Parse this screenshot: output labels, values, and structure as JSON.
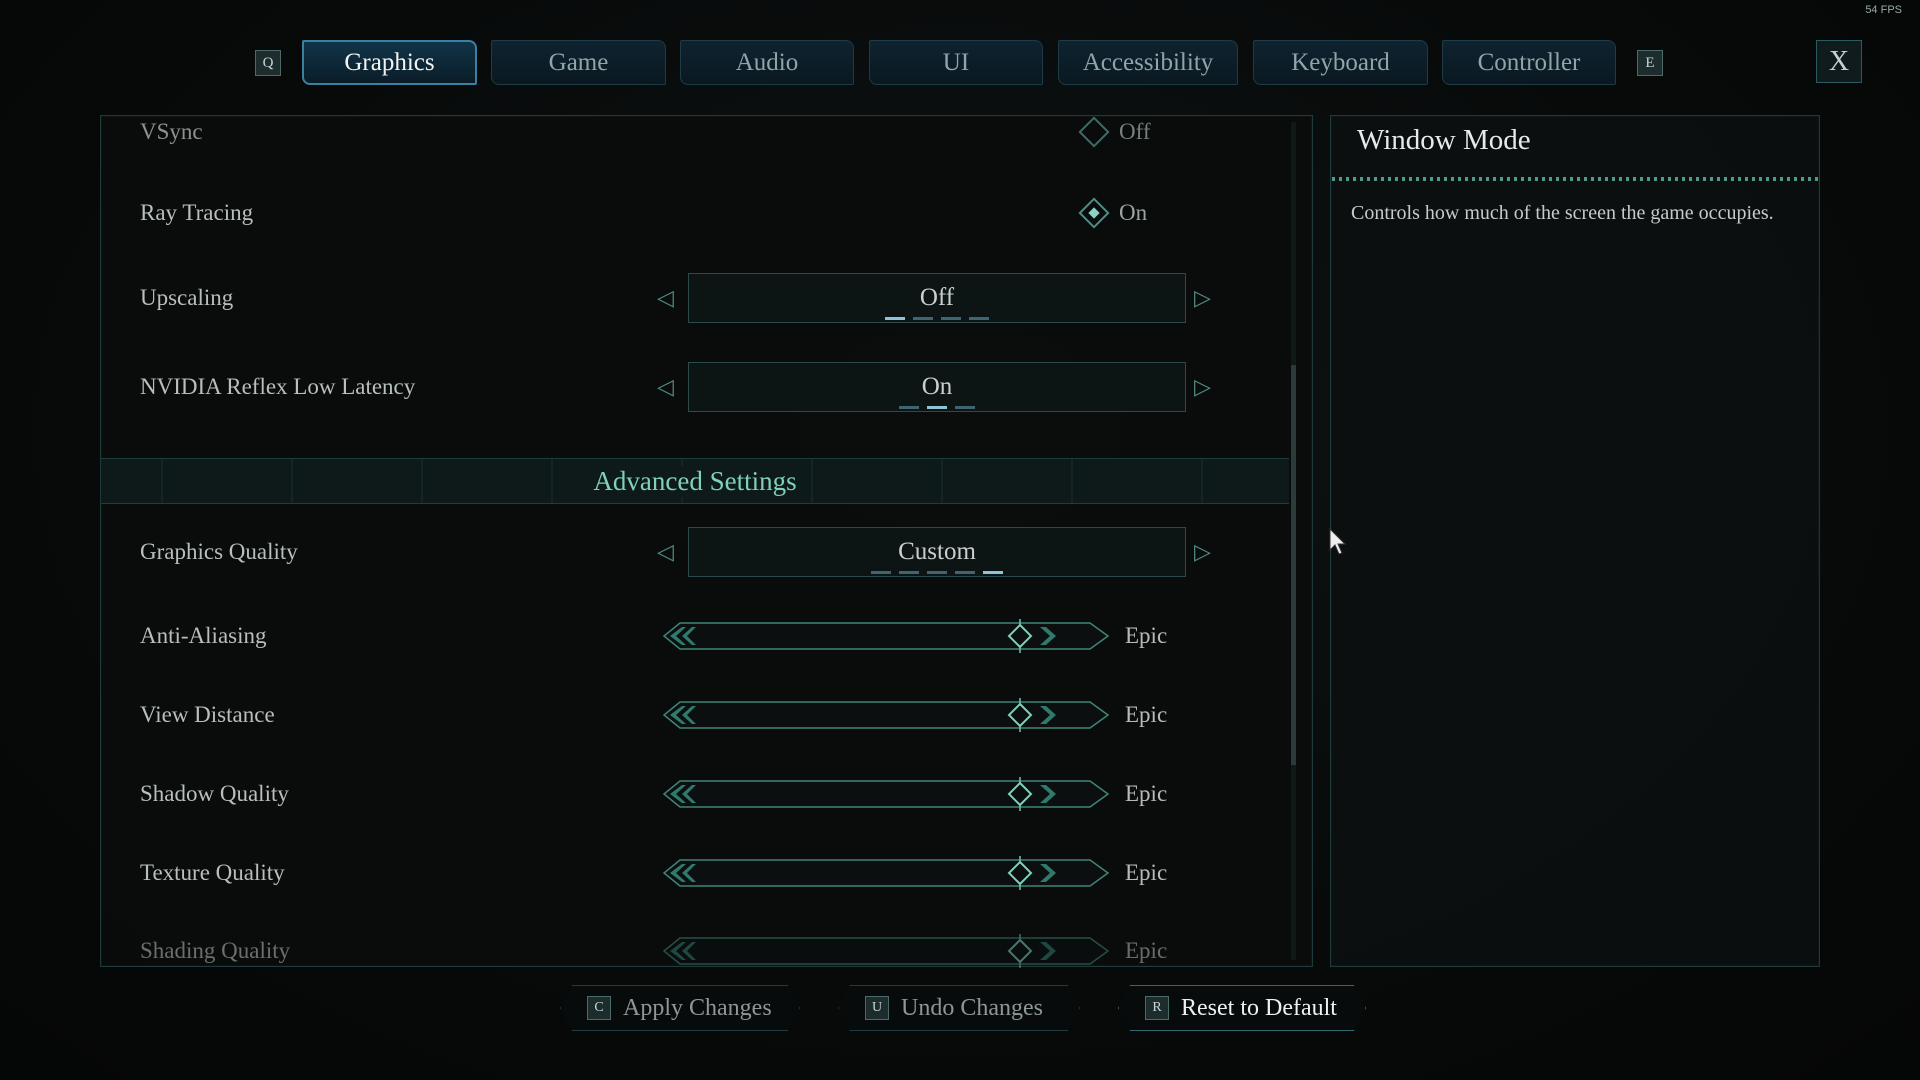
{
  "fps": "54 FPS",
  "tabs": {
    "prev_key": "Q",
    "next_key": "E",
    "items": [
      {
        "label": "Graphics",
        "active": true
      },
      {
        "label": "Game"
      },
      {
        "label": "Audio"
      },
      {
        "label": "UI"
      },
      {
        "label": "Accessibility"
      },
      {
        "label": "Keyboard"
      },
      {
        "label": "Controller"
      }
    ],
    "close_label": "X"
  },
  "settings": {
    "vsync": {
      "label": "VSync",
      "value": "Off",
      "on": false
    },
    "ray_tracing": {
      "label": "Ray Tracing",
      "value": "On",
      "on": true
    },
    "upscaling": {
      "label": "Upscaling",
      "value": "Off",
      "option_count": 4,
      "selected_index": 0
    },
    "reflex": {
      "label": "NVIDIA Reflex Low Latency",
      "value": "On",
      "option_count": 3,
      "selected_index": 1
    },
    "advanced_header": "Advanced Settings",
    "graphics_quality": {
      "label": "Graphics Quality",
      "value": "Custom",
      "option_count": 5,
      "selected_index": 4
    },
    "sliders": [
      {
        "label": "Anti-Aliasing",
        "value": "Epic",
        "level": 1.0
      },
      {
        "label": "View Distance",
        "value": "Epic",
        "level": 1.0
      },
      {
        "label": "Shadow Quality",
        "value": "Epic",
        "level": 1.0
      },
      {
        "label": "Texture Quality",
        "value": "Epic",
        "level": 1.0
      },
      {
        "label": "Shading Quality",
        "value": "Epic",
        "level": 1.0
      }
    ],
    "scroll_position": 0.45
  },
  "info": {
    "title": "Window Mode",
    "description": "Controls how much of the screen the game occupies."
  },
  "footer": [
    {
      "key": "C",
      "label": "Apply Changes"
    },
    {
      "key": "U",
      "label": "Undo Changes"
    },
    {
      "key": "R",
      "label": "Reset to Default"
    }
  ],
  "colors": {
    "accent": "#4f8c84",
    "header": "#7fd0bd",
    "active_tab": "#3d7fa3"
  }
}
